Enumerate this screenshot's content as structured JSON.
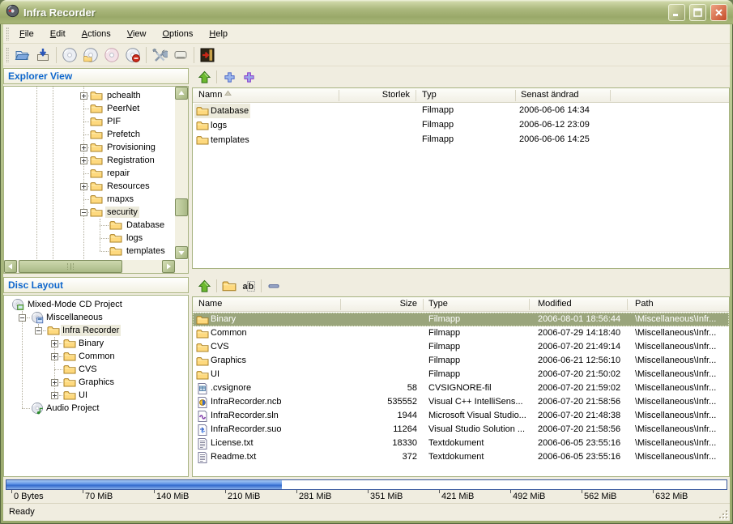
{
  "window": {
    "title": "Infra Recorder"
  },
  "menu": {
    "items": [
      "File",
      "Edit",
      "Actions",
      "View",
      "Options",
      "Help"
    ]
  },
  "toolbar": {
    "icons": [
      {
        "name": "open-project-icon"
      },
      {
        "name": "save-project-icon"
      },
      {
        "sep": true
      },
      {
        "name": "record-disc-icon"
      },
      {
        "name": "burn-compilation-icon"
      },
      {
        "name": "copy-disc-icon"
      },
      {
        "name": "erase-disc-icon"
      },
      {
        "sep": true
      },
      {
        "name": "tools-icon"
      },
      {
        "name": "device-icon"
      },
      {
        "sep": true
      },
      {
        "name": "exit-icon"
      }
    ]
  },
  "explorer": {
    "header": "Explorer View",
    "tree": [
      {
        "label": "pchealth",
        "level": 0,
        "expand": "+"
      },
      {
        "label": "PeerNet",
        "level": 0
      },
      {
        "label": "PIF",
        "level": 0
      },
      {
        "label": "Prefetch",
        "level": 0
      },
      {
        "label": "Provisioning",
        "level": 0,
        "expand": "+"
      },
      {
        "label": "Registration",
        "level": 0,
        "expand": "+"
      },
      {
        "label": "repair",
        "level": 0
      },
      {
        "label": "Resources",
        "level": 0,
        "expand": "+"
      },
      {
        "label": "rnapxs",
        "level": 0
      },
      {
        "label": "security",
        "level": 0,
        "expand": "-",
        "selected": true
      },
      {
        "label": "Database",
        "level": 1
      },
      {
        "label": "logs",
        "level": 1
      },
      {
        "label": "templates",
        "level": 1
      }
    ]
  },
  "explorer_list": {
    "toolbar": [
      {
        "name": "add-up-icon"
      },
      {
        "sep": true
      },
      {
        "name": "add-icon"
      },
      {
        "name": "add-special-icon"
      }
    ],
    "columns": [
      {
        "label": "Namn",
        "sorted": true
      },
      {
        "label": "Storlek",
        "align": "right"
      },
      {
        "label": "Typ"
      },
      {
        "label": "Senast ändrad"
      }
    ],
    "rows": [
      {
        "name": "Database",
        "icon": "folder-icon",
        "size": "",
        "type": "Filmapp",
        "modified": "2006-06-06 14:34",
        "selected": true
      },
      {
        "name": "logs",
        "icon": "folder-icon",
        "size": "",
        "type": "Filmapp",
        "modified": "2006-06-12 23:09"
      },
      {
        "name": "templates",
        "icon": "folder-icon",
        "size": "",
        "type": "Filmapp",
        "modified": "2006-06-06 14:25"
      }
    ]
  },
  "disc": {
    "header": "Disc Layout",
    "tree": [
      {
        "label": "Mixed-Mode CD Project",
        "icon": "mixed-cd-icon",
        "level": 0
      },
      {
        "label": "Miscellaneous",
        "icon": "data-cd-icon",
        "level": 1,
        "expand": "-"
      },
      {
        "label": "Infra Recorder",
        "icon": "folder-icon",
        "level": 2,
        "expand": "-",
        "selected": true
      },
      {
        "label": "Binary",
        "icon": "folder-icon",
        "level": 3,
        "expand": "+"
      },
      {
        "label": "Common",
        "icon": "folder-icon",
        "level": 3,
        "expand": "+"
      },
      {
        "label": "CVS",
        "icon": "folder-icon",
        "level": 3
      },
      {
        "label": "Graphics",
        "icon": "folder-icon",
        "level": 3,
        "expand": "+"
      },
      {
        "label": "UI",
        "icon": "folder-icon",
        "level": 3,
        "expand": "+"
      },
      {
        "label": "Audio Project",
        "icon": "audio-cd-icon",
        "level": 1
      }
    ]
  },
  "disc_list": {
    "toolbar": [
      {
        "name": "up-level-icon"
      },
      {
        "sep": true
      },
      {
        "name": "new-folder-icon"
      },
      {
        "name": "rename-icon"
      },
      {
        "sep": true
      },
      {
        "name": "remove-icon"
      }
    ],
    "columns": [
      {
        "label": "Name"
      },
      {
        "label": "Size",
        "align": "right"
      },
      {
        "label": "Type"
      },
      {
        "label": "Modified"
      },
      {
        "label": "Path"
      }
    ],
    "rows": [
      {
        "name": "Binary",
        "icon": "folder-icon",
        "size": "",
        "type": "Filmapp",
        "modified": "2006-08-01 18:56:44",
        "path": "\\Miscellaneous\\Infr...",
        "selected": true
      },
      {
        "name": "Common",
        "icon": "folder-icon",
        "size": "",
        "type": "Filmapp",
        "modified": "2006-07-29 14:18:40",
        "path": "\\Miscellaneous\\Infr..."
      },
      {
        "name": "CVS",
        "icon": "folder-icon",
        "size": "",
        "type": "Filmapp",
        "modified": "2006-07-20 21:49:14",
        "path": "\\Miscellaneous\\Infr..."
      },
      {
        "name": "Graphics",
        "icon": "folder-icon",
        "size": "",
        "type": "Filmapp",
        "modified": "2006-06-21 12:56:10",
        "path": "\\Miscellaneous\\Infr..."
      },
      {
        "name": "UI",
        "icon": "folder-icon",
        "size": "",
        "type": "Filmapp",
        "modified": "2006-07-20 21:50:02",
        "path": "\\Miscellaneous\\Infr..."
      },
      {
        "name": ".cvsignore",
        "icon": "cvsignore-file-icon",
        "size": "58",
        "type": "CVSIGNORE-fil",
        "modified": "2006-07-20 21:59:02",
        "path": "\\Miscellaneous\\Infr..."
      },
      {
        "name": "InfraRecorder.ncb",
        "icon": "ncb-file-icon",
        "size": "535552",
        "type": "Visual C++ IntelliSens...",
        "modified": "2006-07-20 21:58:56",
        "path": "\\Miscellaneous\\Infr..."
      },
      {
        "name": "InfraRecorder.sln",
        "icon": "sln-file-icon",
        "size": "1944",
        "type": "Microsoft Visual Studio...",
        "modified": "2006-07-20 21:48:38",
        "path": "\\Miscellaneous\\Infr..."
      },
      {
        "name": "InfraRecorder.suo",
        "icon": "suo-file-icon",
        "size": "11264",
        "type": "Visual Studio Solution ...",
        "modified": "2006-07-20 21:58:56",
        "path": "\\Miscellaneous\\Infr..."
      },
      {
        "name": "License.txt",
        "icon": "text-file-icon",
        "size": "18330",
        "type": "Textdokument",
        "modified": "2006-06-05 23:55:16",
        "path": "\\Miscellaneous\\Infr..."
      },
      {
        "name": "Readme.txt",
        "icon": "text-file-icon",
        "size": "372",
        "type": "Textdokument",
        "modified": "2006-06-05 23:55:16",
        "path": "\\Miscellaneous\\Infr..."
      }
    ]
  },
  "capacity": {
    "labels": [
      "0 Bytes",
      "70 MiB",
      "140 MiB",
      "210 MiB",
      "281 MiB",
      "351 MiB",
      "421 MiB",
      "492 MiB",
      "562 MiB",
      "632 MiB"
    ],
    "fill_ratio": 0.382
  },
  "statusbar": {
    "text": "Ready"
  }
}
